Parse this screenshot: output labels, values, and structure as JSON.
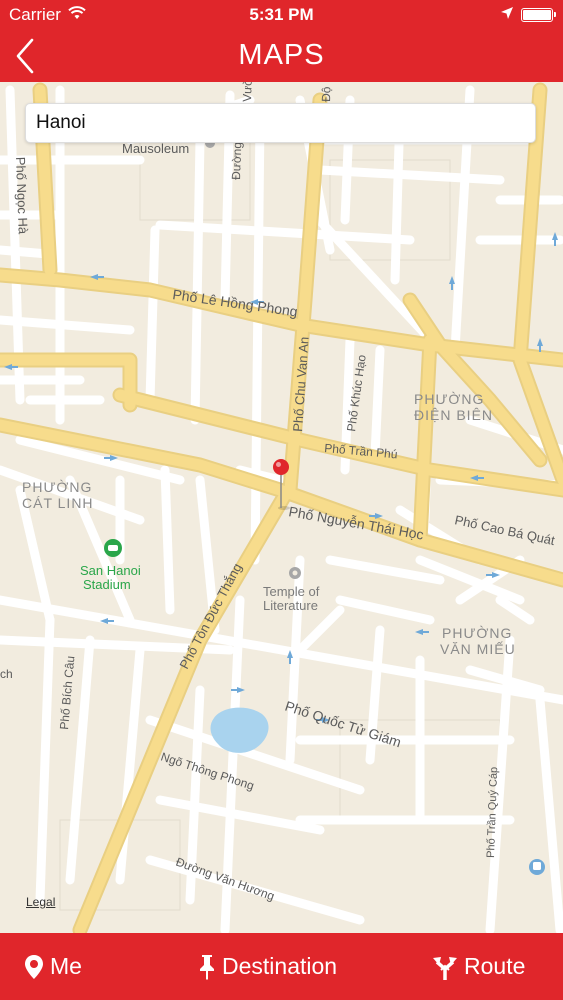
{
  "status_bar": {
    "carrier": "Carrier",
    "time": "5:31 PM"
  },
  "nav": {
    "title": "MAPS"
  },
  "search": {
    "value": "Hanoi"
  },
  "map": {
    "labels": {
      "mausoleum": "Mausoleum",
      "le_hong_phong": "Phố Lê Hồng Phong",
      "ngoc_ha": "Phố Ngọc Hà",
      "chu_van_an": "Phố Chu Van An",
      "khuc_hao": "Phố Khúc Hạo",
      "tran_phu": "Phố Trần Phú",
      "nguyen_thai_hoc": "Phố Nguyễn Thái Học",
      "cao_ba_quat": "Phố Cao Bá Quát",
      "ton_duc_thang": "Phố Tôn Đức Thắng",
      "quoc_tu_giam": "Phố Quốc Tử Giám",
      "bich_cau": "Phố Bích Câu",
      "ngo_thong_phong": "Ngõ Thông Phong",
      "van_huong": "Đường Văn Hương",
      "tran_quy_cap": "Phố Trần Quý Cáp",
      "duong_top": "Đường",
      "vuo_top": "Vườ",
      "do_top": "Độ",
      "ech": "ch"
    },
    "districts": {
      "dien_bien": [
        "PHƯỜNG",
        "ĐIỆN BIÊN"
      ],
      "cat_linh": [
        "PHƯỜNG",
        "CÁT LINH"
      ],
      "van_mieu": [
        "PHƯỜNG",
        "VĂN MIẾU"
      ]
    },
    "pois": {
      "stadium": [
        "San Hanoi",
        "Stadium"
      ],
      "temple": [
        "Temple of",
        "Literature"
      ]
    },
    "legal": "Legal",
    "colors": {
      "land": "#f2ecdf",
      "street": "#ffffff",
      "major_road": "#f7dc8c",
      "water": "#a9d3ee",
      "poi_green": "#2aa64a",
      "pin": "#e0262b"
    }
  },
  "tabs": {
    "me": "Me",
    "destination": "Destination",
    "route": "Route"
  },
  "icons": {
    "back": "chevron-left-icon",
    "me": "location-pin-icon",
    "destination": "push-pin-icon",
    "route": "route-arrows-icon"
  },
  "colors": {
    "brand_red": "#e0262b"
  }
}
